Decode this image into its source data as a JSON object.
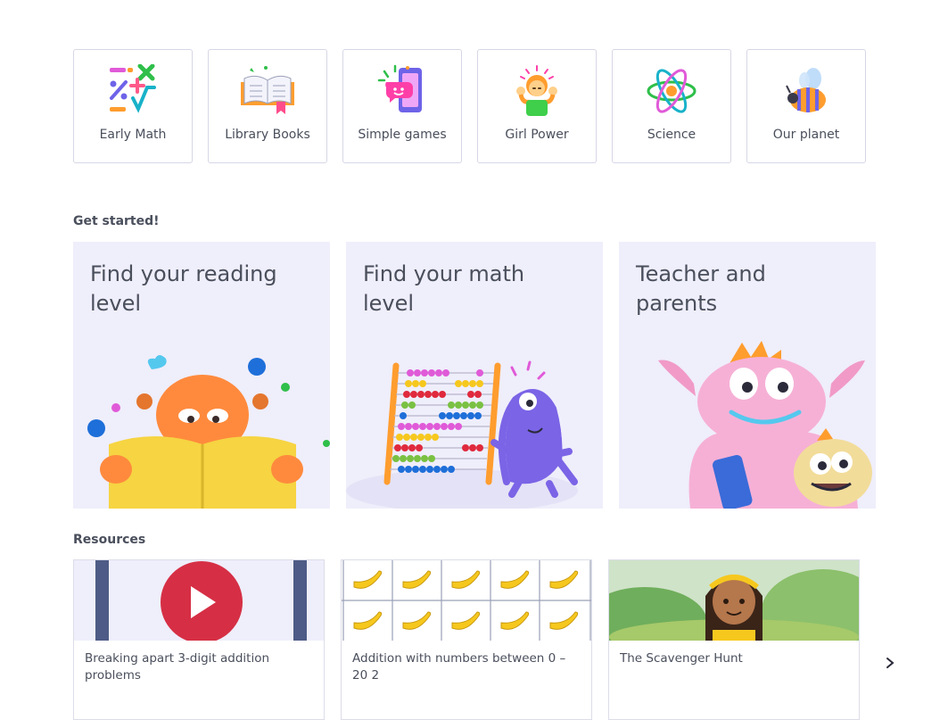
{
  "categories": [
    {
      "label": "Early Math",
      "icon": "math-symbols-icon"
    },
    {
      "label": "Library Books",
      "icon": "open-book-icon"
    },
    {
      "label": "Simple games",
      "icon": "phone-chat-icon"
    },
    {
      "label": "Girl Power",
      "icon": "girl-power-icon"
    },
    {
      "label": "Science",
      "icon": "atom-icon"
    },
    {
      "label": "Our planet",
      "icon": "bee-icon"
    }
  ],
  "get_started": {
    "title": "Get started!",
    "cards": [
      {
        "title": "Find your reading level"
      },
      {
        "title": "Find your math level"
      },
      {
        "title": "Teacher and parents"
      }
    ]
  },
  "resources": {
    "title": "Resources",
    "items": [
      {
        "caption": "Breaking apart 3-digit addition problems",
        "thumb": "video-play-icon"
      },
      {
        "caption": "Addition with numbers between 0 – 20 2",
        "thumb": "banana-grid"
      },
      {
        "caption": "The Scavenger Hunt",
        "thumb": "girl-illustration"
      }
    ],
    "next_icon": "chevron-right-icon"
  },
  "colors": {
    "card_bg": "#efeefb",
    "play_red": "#d62f45",
    "text": "#4a4f5c",
    "border": "#d6d7e6"
  }
}
